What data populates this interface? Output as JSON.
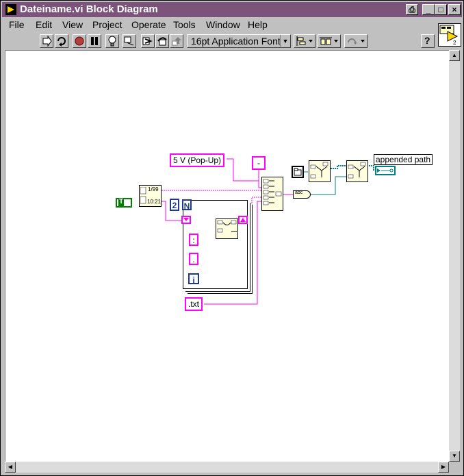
{
  "window": {
    "title": "Dateiname.vi Block Diagram",
    "controls": {
      "print": "⎙",
      "minimize": "_",
      "maximize": "□",
      "close": "×"
    }
  },
  "menu": [
    {
      "label": "File"
    },
    {
      "label": "Edit"
    },
    {
      "label": "View"
    },
    {
      "label": "Project"
    },
    {
      "label": "Operate"
    },
    {
      "label": "Tools"
    },
    {
      "label": "Window"
    },
    {
      "label": "Help"
    }
  ],
  "toolbar": {
    "font": "16pt Application Font",
    "help": "?"
  },
  "vi_icon": {
    "number": "2"
  },
  "diagram": {
    "string_const_5v": "5 V (Pop-Up)",
    "string_const_dash": "-",
    "string_const_colon": ":",
    "string_const_dot": ".",
    "string_const_txt": ".txt",
    "numeric_const": "2",
    "loop_count": "N",
    "loop_iteration": "i",
    "bool_const": "T",
    "date_top": "1/99",
    "date_bottom": "10:21",
    "indicator_label": "appended path",
    "concat_output_text": "abc"
  },
  "colors": {
    "titlebar": "#7b537b",
    "string_wire": "#ff00ff",
    "path_wire": "#008080",
    "numeric": "#1e3a8c",
    "boolean": "#008000"
  }
}
